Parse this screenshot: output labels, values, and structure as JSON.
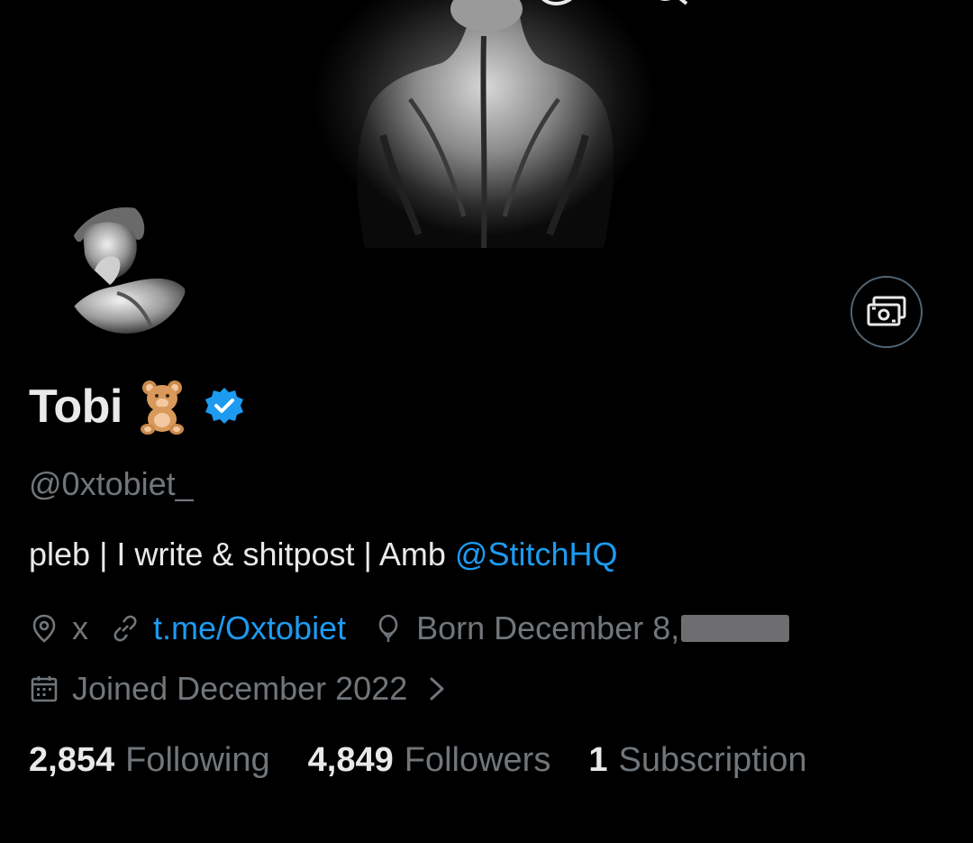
{
  "header": {
    "back_icon": "back-arrow-icon",
    "actions": [
      "grok-icon",
      "search-icon",
      "edit-list-icon",
      "more-icon"
    ]
  },
  "profile": {
    "display_name": "Tobi",
    "name_emoji": "teddy-bear-emoji",
    "verified": true,
    "handle": "@0xtobiet_",
    "bio_text": "pleb | I write & shitpost | Amb ",
    "bio_mention": "@StitchHQ",
    "location": "x",
    "website": "t.me/Oxtobiet",
    "birthday": "Born December 8,",
    "joined": "Joined December 2022",
    "subscribe_icon": "money-icon"
  },
  "stats": {
    "following_count": "2,854",
    "following_label": "Following",
    "followers_count": "4,849",
    "followers_label": "Followers",
    "subscriptions_count": "1",
    "subscriptions_label": "Subscription"
  },
  "colors": {
    "background": "#000000",
    "primary_text": "#e7e9ea",
    "secondary_text": "#71767b",
    "accent": "#1d9bf0",
    "verified": "#1d9bf0"
  }
}
